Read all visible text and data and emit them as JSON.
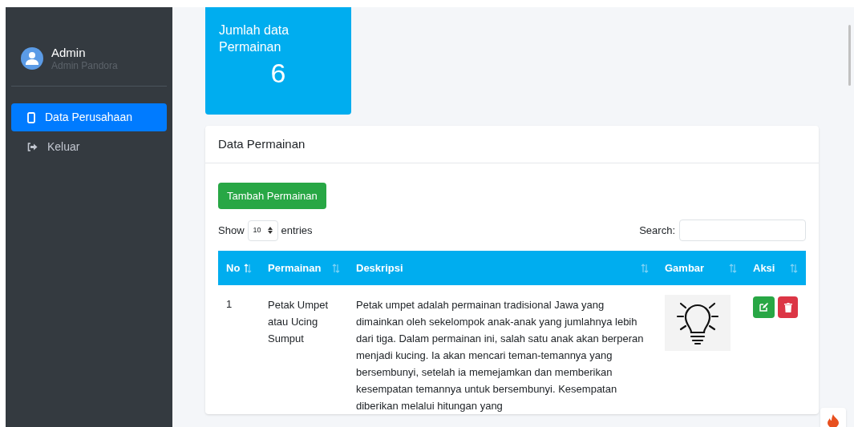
{
  "sidebar": {
    "user": {
      "name": "Admin",
      "role": "Admin Pandora"
    },
    "items": [
      {
        "label": "Data Perusahaan",
        "kind": "phone",
        "selected": true
      },
      {
        "label": "Keluar",
        "kind": "logout",
        "selected": false
      }
    ]
  },
  "stat_card": {
    "label": "Jumlah data Permainan",
    "value": "6"
  },
  "card": {
    "title": "Data Permainan",
    "add_button": "Tambah Permainan",
    "length": {
      "before": "Show",
      "value": "10",
      "after": "entries"
    },
    "search": {
      "label": "Search:"
    },
    "table": {
      "columns": [
        {
          "label": "No",
          "sorted": true
        },
        {
          "label": "Permainan",
          "sorted": false
        },
        {
          "label": "Deskripsi",
          "sorted": false
        },
        {
          "label": "Gambar",
          "sorted": false
        },
        {
          "label": "Aksi",
          "sorted": false
        }
      ],
      "rows": [
        {
          "no": "1",
          "name": "Petak Umpet atau Ucing Sumput",
          "description": "Petak umpet adalah permainan tradisional Jawa yang dimainkan oleh sekelompok anak-anak yang jumlahnya lebih dari tiga. Dalam permainan ini, salah satu anak akan berperan menjadi kucing. Ia akan mencari teman-temannya yang bersembunyi, setelah ia memejamkan dan memberikan kesempatan temannya untuk bersembunyi. Kesempatan diberikan melalui hitungan yang"
        }
      ]
    }
  }
}
